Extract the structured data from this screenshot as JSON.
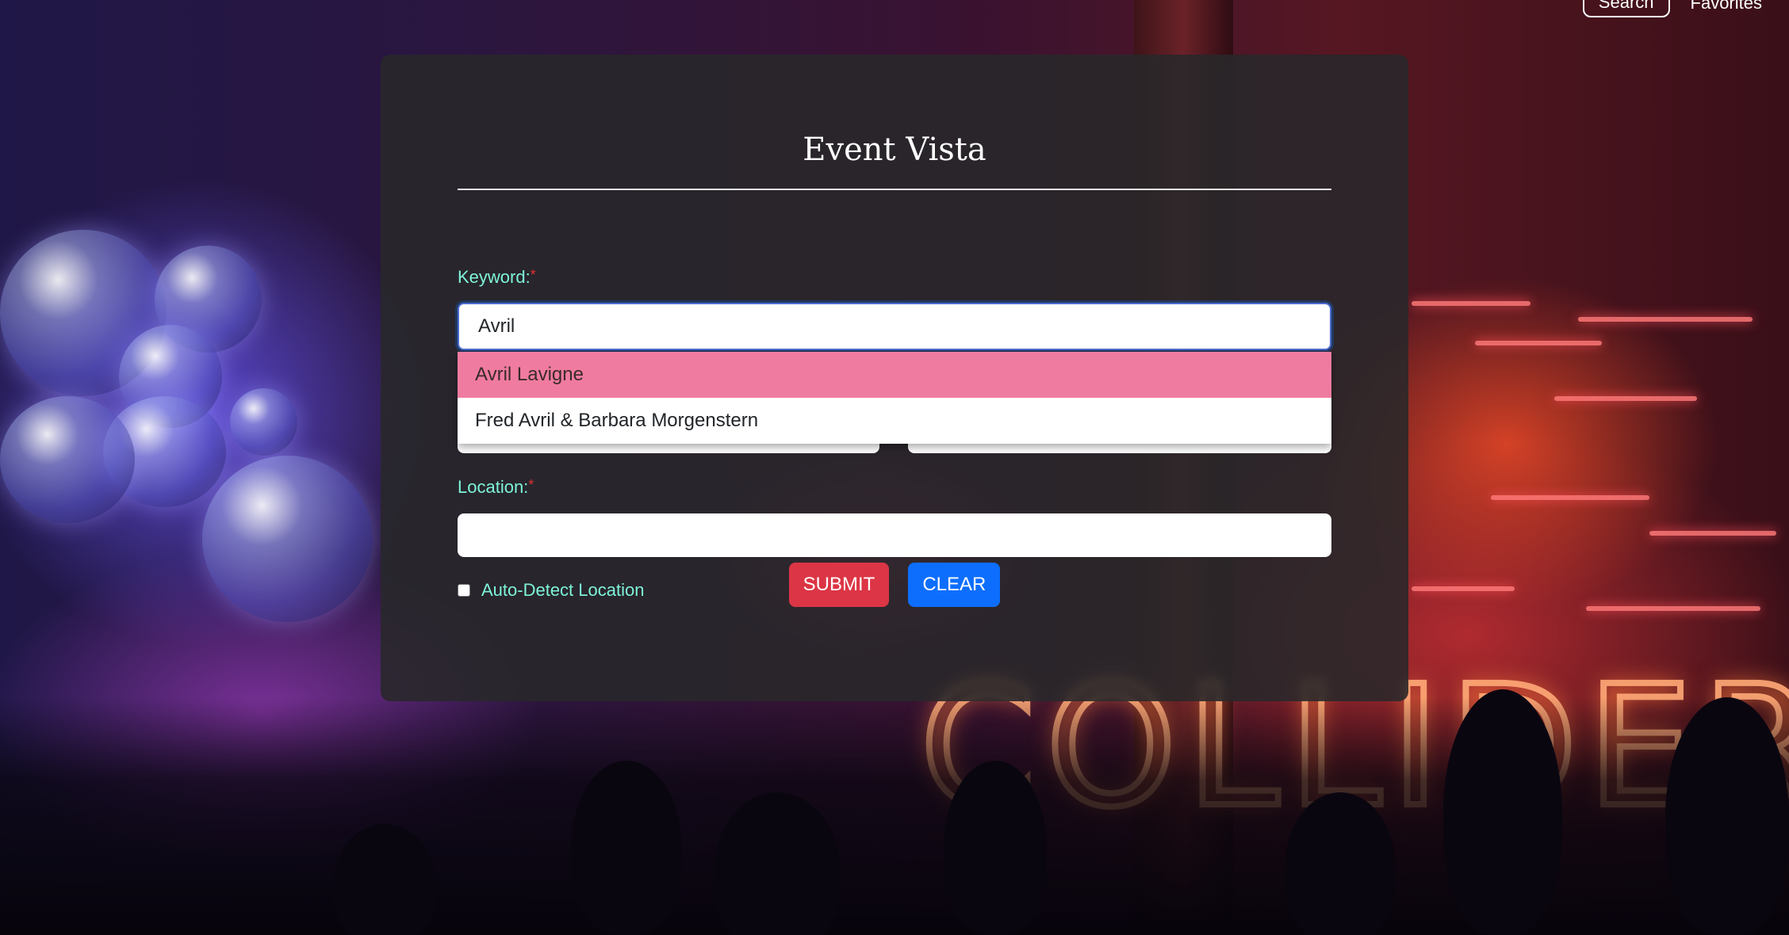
{
  "nav": {
    "search_label": "Search",
    "favorites_label": "Favorites"
  },
  "form": {
    "title": "Event Vista",
    "keyword": {
      "label": "Keyword:",
      "required_mark": "*",
      "value": "Avril"
    },
    "suggestions": [
      {
        "label": "Avril Lavigne",
        "active": true
      },
      {
        "label": "Fred Avril & Barbara Morgenstern",
        "active": false
      }
    ],
    "location": {
      "label": "Location:",
      "required_mark": "*",
      "value": ""
    },
    "auto_detect": {
      "label": "Auto-Detect Location",
      "checked": false
    },
    "submit_label": "SUBMIT",
    "clear_label": "CLEAR"
  },
  "colors": {
    "label": "#7ef5d9",
    "submit": "#dc3545",
    "clear": "#0d6efd",
    "suggestion_highlight": "#f07ba0"
  }
}
